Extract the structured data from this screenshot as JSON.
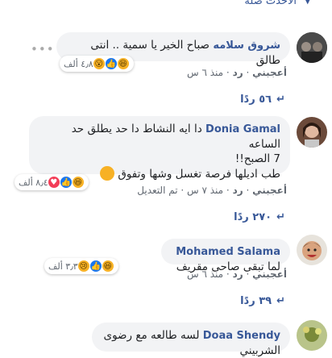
{
  "top_label": "الأحدث صلة",
  "comments": [
    {
      "author": "شروق سلامه",
      "text": "صباح الخير يا سمية .. انتى طالق",
      "reaction_count": "٤٫٨ ألف",
      "like_label": "أعجبني",
      "reply_label": "رد",
      "time": "منذ ٦ س",
      "replies": "٥٦ ردًا"
    },
    {
      "author": "Donia Gamal",
      "text_line1": "دا ايه النشاط دا حد يطلق حد الساعه",
      "text_line2": "7 الصبح!!",
      "text_line3": "طب اديلها فرصة تغسل وشها وتفوق",
      "reaction_count": "٨٫٤ ألف",
      "like_label": "أعجبني",
      "reply_label": "رد",
      "time": "منذ ٧ س",
      "edited": "تم التعديل",
      "replies": "٢٧٠ ردًا"
    },
    {
      "author": "Mohamed Salama",
      "text": "لما تبقى صاحى مقريف",
      "reaction_count": "٣٫٣ ألف",
      "like_label": "أعجبني",
      "reply_label": "رد",
      "time": "منذ ٦ س",
      "replies": "٣٩ ردًا"
    },
    {
      "author": "Doaa Shendy",
      "text": "لسه طالعه مع رضوى الشربيني"
    }
  ],
  "colors": {
    "link": "#385898",
    "bubble": "#f2f3f5",
    "meta": "#606770"
  }
}
